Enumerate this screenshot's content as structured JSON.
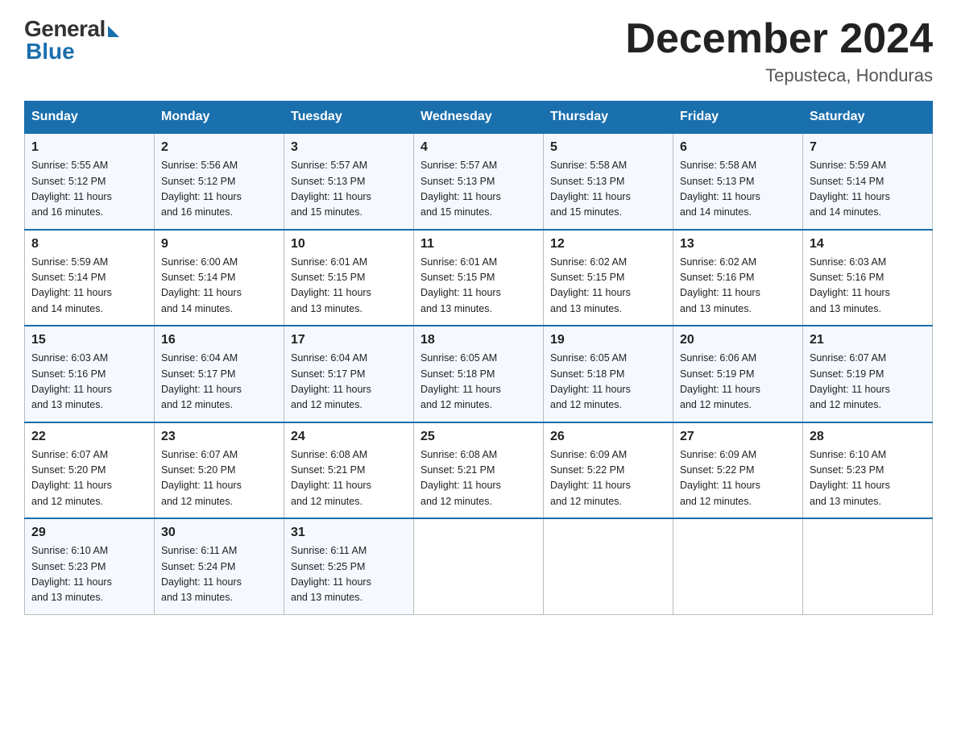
{
  "logo": {
    "general": "General",
    "blue": "Blue"
  },
  "title": "December 2024",
  "location": "Tepusteca, Honduras",
  "days_of_week": [
    "Sunday",
    "Monday",
    "Tuesday",
    "Wednesday",
    "Thursday",
    "Friday",
    "Saturday"
  ],
  "weeks": [
    [
      {
        "day": "1",
        "sunrise": "5:55 AM",
        "sunset": "5:12 PM",
        "daylight": "11 hours and 16 minutes."
      },
      {
        "day": "2",
        "sunrise": "5:56 AM",
        "sunset": "5:12 PM",
        "daylight": "11 hours and 16 minutes."
      },
      {
        "day": "3",
        "sunrise": "5:57 AM",
        "sunset": "5:13 PM",
        "daylight": "11 hours and 15 minutes."
      },
      {
        "day": "4",
        "sunrise": "5:57 AM",
        "sunset": "5:13 PM",
        "daylight": "11 hours and 15 minutes."
      },
      {
        "day": "5",
        "sunrise": "5:58 AM",
        "sunset": "5:13 PM",
        "daylight": "11 hours and 15 minutes."
      },
      {
        "day": "6",
        "sunrise": "5:58 AM",
        "sunset": "5:13 PM",
        "daylight": "11 hours and 14 minutes."
      },
      {
        "day": "7",
        "sunrise": "5:59 AM",
        "sunset": "5:14 PM",
        "daylight": "11 hours and 14 minutes."
      }
    ],
    [
      {
        "day": "8",
        "sunrise": "5:59 AM",
        "sunset": "5:14 PM",
        "daylight": "11 hours and 14 minutes."
      },
      {
        "day": "9",
        "sunrise": "6:00 AM",
        "sunset": "5:14 PM",
        "daylight": "11 hours and 14 minutes."
      },
      {
        "day": "10",
        "sunrise": "6:01 AM",
        "sunset": "5:15 PM",
        "daylight": "11 hours and 13 minutes."
      },
      {
        "day": "11",
        "sunrise": "6:01 AM",
        "sunset": "5:15 PM",
        "daylight": "11 hours and 13 minutes."
      },
      {
        "day": "12",
        "sunrise": "6:02 AM",
        "sunset": "5:15 PM",
        "daylight": "11 hours and 13 minutes."
      },
      {
        "day": "13",
        "sunrise": "6:02 AM",
        "sunset": "5:16 PM",
        "daylight": "11 hours and 13 minutes."
      },
      {
        "day": "14",
        "sunrise": "6:03 AM",
        "sunset": "5:16 PM",
        "daylight": "11 hours and 13 minutes."
      }
    ],
    [
      {
        "day": "15",
        "sunrise": "6:03 AM",
        "sunset": "5:16 PM",
        "daylight": "11 hours and 13 minutes."
      },
      {
        "day": "16",
        "sunrise": "6:04 AM",
        "sunset": "5:17 PM",
        "daylight": "11 hours and 12 minutes."
      },
      {
        "day": "17",
        "sunrise": "6:04 AM",
        "sunset": "5:17 PM",
        "daylight": "11 hours and 12 minutes."
      },
      {
        "day": "18",
        "sunrise": "6:05 AM",
        "sunset": "5:18 PM",
        "daylight": "11 hours and 12 minutes."
      },
      {
        "day": "19",
        "sunrise": "6:05 AM",
        "sunset": "5:18 PM",
        "daylight": "11 hours and 12 minutes."
      },
      {
        "day": "20",
        "sunrise": "6:06 AM",
        "sunset": "5:19 PM",
        "daylight": "11 hours and 12 minutes."
      },
      {
        "day": "21",
        "sunrise": "6:07 AM",
        "sunset": "5:19 PM",
        "daylight": "11 hours and 12 minutes."
      }
    ],
    [
      {
        "day": "22",
        "sunrise": "6:07 AM",
        "sunset": "5:20 PM",
        "daylight": "11 hours and 12 minutes."
      },
      {
        "day": "23",
        "sunrise": "6:07 AM",
        "sunset": "5:20 PM",
        "daylight": "11 hours and 12 minutes."
      },
      {
        "day": "24",
        "sunrise": "6:08 AM",
        "sunset": "5:21 PM",
        "daylight": "11 hours and 12 minutes."
      },
      {
        "day": "25",
        "sunrise": "6:08 AM",
        "sunset": "5:21 PM",
        "daylight": "11 hours and 12 minutes."
      },
      {
        "day": "26",
        "sunrise": "6:09 AM",
        "sunset": "5:22 PM",
        "daylight": "11 hours and 12 minutes."
      },
      {
        "day": "27",
        "sunrise": "6:09 AM",
        "sunset": "5:22 PM",
        "daylight": "11 hours and 12 minutes."
      },
      {
        "day": "28",
        "sunrise": "6:10 AM",
        "sunset": "5:23 PM",
        "daylight": "11 hours and 13 minutes."
      }
    ],
    [
      {
        "day": "29",
        "sunrise": "6:10 AM",
        "sunset": "5:23 PM",
        "daylight": "11 hours and 13 minutes."
      },
      {
        "day": "30",
        "sunrise": "6:11 AM",
        "sunset": "5:24 PM",
        "daylight": "11 hours and 13 minutes."
      },
      {
        "day": "31",
        "sunrise": "6:11 AM",
        "sunset": "5:25 PM",
        "daylight": "11 hours and 13 minutes."
      },
      null,
      null,
      null,
      null
    ]
  ],
  "labels": {
    "sunrise": "Sunrise:",
    "sunset": "Sunset:",
    "daylight": "Daylight:"
  }
}
